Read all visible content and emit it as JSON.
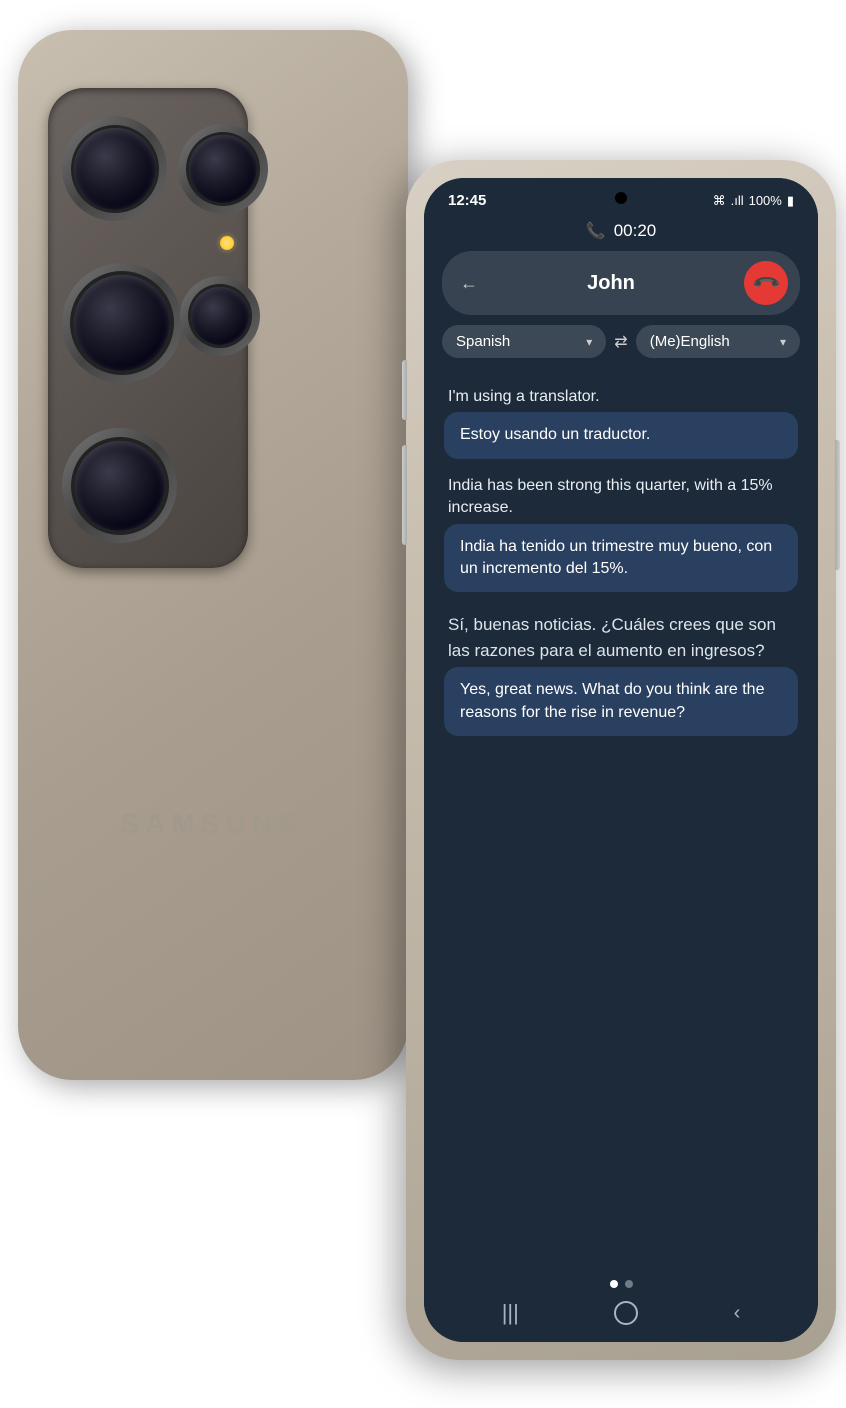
{
  "back_phone": {
    "samsung_label": "SAMSUNG"
  },
  "status_bar": {
    "time": "12:45",
    "wifi": "WiFi",
    "signal": "Signal",
    "battery_pct": "100%"
  },
  "call": {
    "duration": "00:20",
    "caller_name": "John",
    "end_call_label": "End Call"
  },
  "language_selector": {
    "from_lang": "Spanish",
    "to_lang": "(Me)English",
    "swap_label": "Swap languages"
  },
  "messages": [
    {
      "plain": "I'm using a translator.",
      "translated": "Estoy usando un traductor."
    },
    {
      "plain": "India has been strong this quarter, with a 15% increase.",
      "translated": "India ha tenido un trimestre muy bueno, con un incremento del 15%."
    },
    {
      "plain": "Sí, buenas noticias. ¿Cuáles crees que son las razones para el aumento en ingresos?",
      "translated": "Yes, great news. What do you think are the reasons for the rise in revenue?"
    }
  ],
  "nav": {
    "dots": [
      "active",
      "inactive"
    ],
    "recents_icon": "|||",
    "home_icon": "○",
    "back_icon": "<"
  },
  "colors": {
    "screen_bg": "#1c2a3a",
    "bubble_bg": "#2a4060",
    "accent_red": "#e53935",
    "text_white": "#ffffff"
  }
}
